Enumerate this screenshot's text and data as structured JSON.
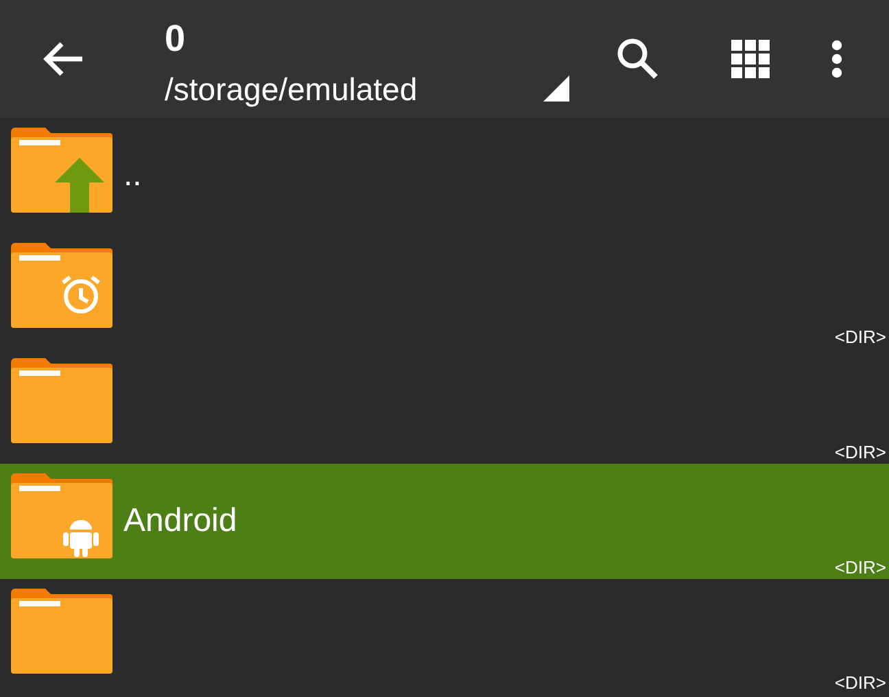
{
  "toolbar": {
    "title": "0",
    "path": "/storage/emulated"
  },
  "files": [
    {
      "kind": "up",
      "name": "..",
      "selected": false
    },
    {
      "kind": "alarm",
      "size": "<DIR>",
      "selected": false
    },
    {
      "kind": "plain",
      "size": "<DIR>",
      "selected": false
    },
    {
      "kind": "android",
      "name": "Android",
      "size": "<DIR>",
      "selected": true
    },
    {
      "kind": "plain",
      "size": "<DIR>",
      "selected": false
    }
  ]
}
